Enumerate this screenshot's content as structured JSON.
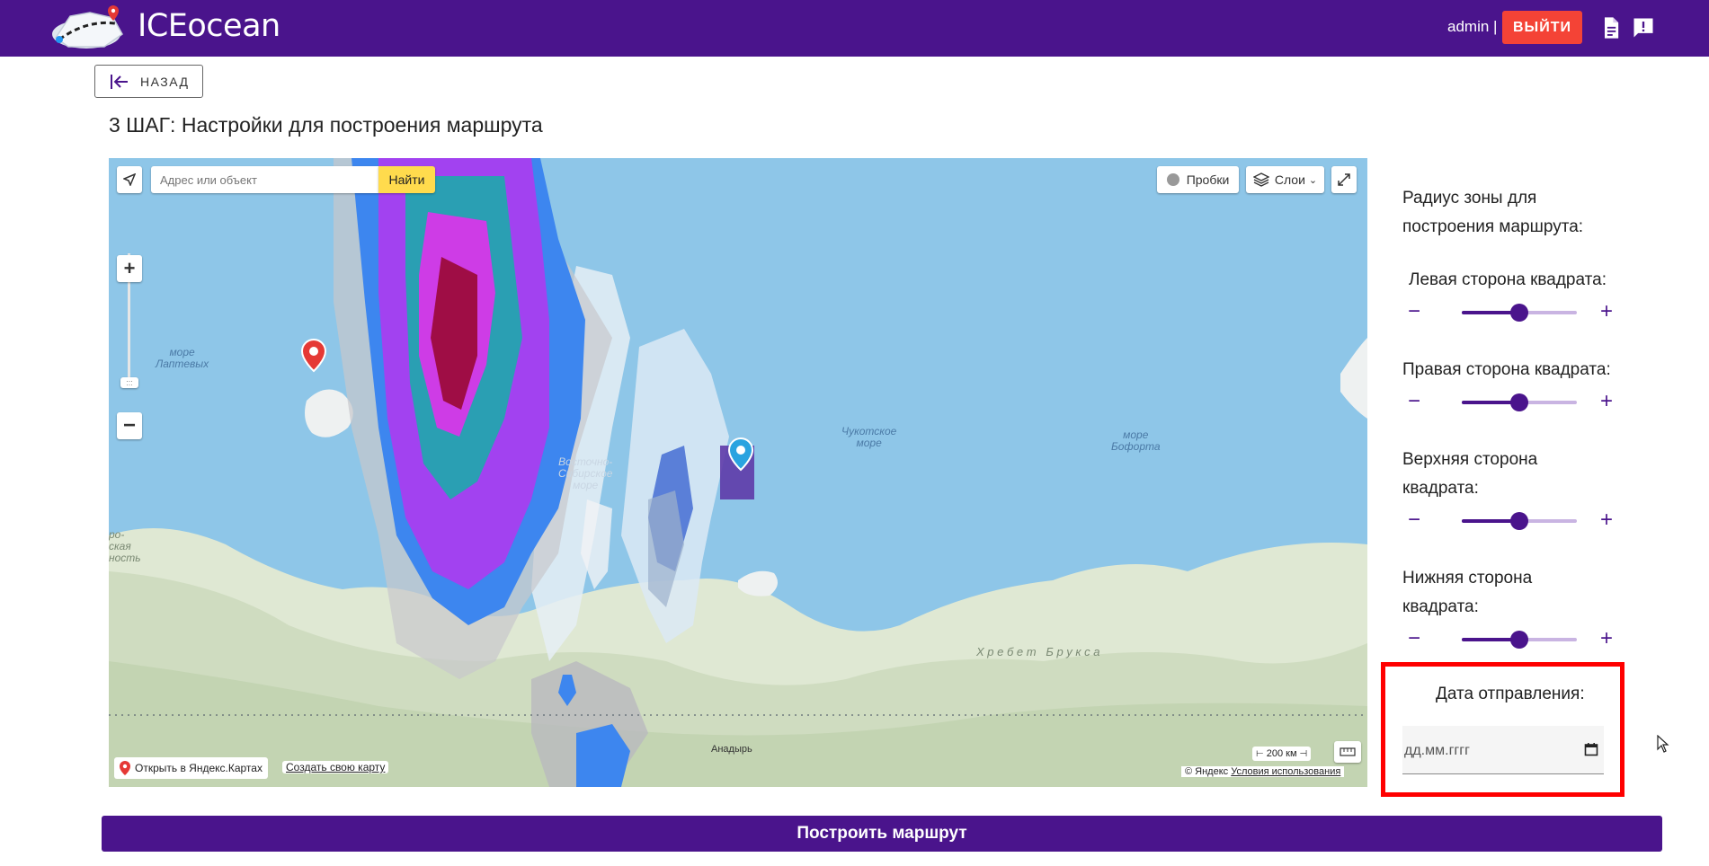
{
  "header": {
    "app_title": "ICEocean",
    "user_label": "admin |",
    "logout_label": "ВЫЙТИ",
    "icons": [
      "logo-icon",
      "document-icon",
      "feedback-icon"
    ]
  },
  "back_label": "НАЗАД",
  "page_title": "3 ШАГ: Настройки для построения маршрута",
  "map": {
    "search_placeholder": "Адрес или объект",
    "find_label": "Найти",
    "traffic_label": "Пробки",
    "layers_label": "Слои",
    "labels": {
      "laptev": "море\nЛаптевых",
      "east_siberian": "Восточно-\nСибирское\nморе",
      "chukchi": "Чукотское\nморе",
      "beaufort": "море\nБофорта",
      "brooks": "Х р е б е т   Б р у к с а",
      "anadyr": "Анадырь",
      "left_edge": "ро-\nская\nность"
    },
    "scale_label": "200 км",
    "open_in_yandex": "Открыть в Яндекс.Картах",
    "create_map": "Создать свою карту",
    "copyright": "© Яндекс",
    "terms": "Условия использования"
  },
  "panel": {
    "heading": "Радиус зоны для построения маршрута:",
    "sliders": [
      {
        "label": "Левая сторона квадрата:",
        "value": 0.5
      },
      {
        "label": "Правая сторона квадрата:",
        "value": 0.5
      },
      {
        "label": "Верхняя сторона квадрата:",
        "value": 0.5
      },
      {
        "label": "Нижняя сторона квадрата:",
        "value": 0.5
      }
    ],
    "date_label": "Дата отправления:",
    "date_placeholder": "дд.мм.гггг"
  },
  "build_label": "Построить маршрут",
  "colors": {
    "primary": "#4a148c",
    "danger": "#f44336",
    "highlight": "#ff0000",
    "map_water": "#8ec6e8"
  }
}
